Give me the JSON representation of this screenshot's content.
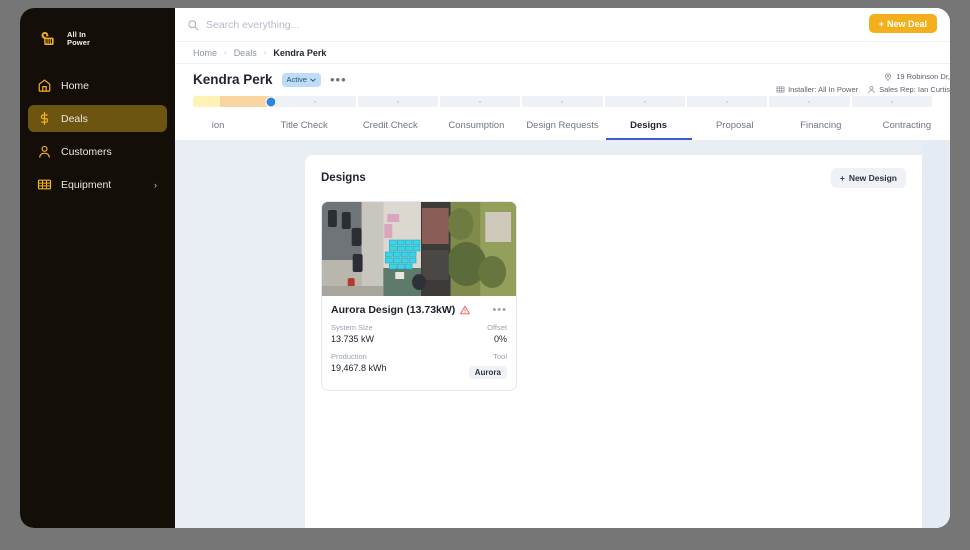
{
  "brand": {
    "name_line1": "All In",
    "name_line2": "Power",
    "accent": "#f3b01c"
  },
  "sidebar": {
    "items": [
      {
        "label": "Home",
        "icon": "home-icon",
        "active": false,
        "chevron": ""
      },
      {
        "label": "Deals",
        "icon": "dollar-icon",
        "active": true,
        "chevron": ""
      },
      {
        "label": "Customers",
        "icon": "person-icon",
        "active": false,
        "chevron": ""
      },
      {
        "label": "Equipment",
        "icon": "solar-panel-icon",
        "active": false,
        "chevron": "›"
      }
    ]
  },
  "topbar": {
    "search_placeholder": "Search everything...",
    "search_value": "",
    "new_deal_label": "New Deal",
    "new_deal_plus": "+"
  },
  "breadcrumb": {
    "items": [
      "Home",
      "Deals",
      "Kendra Perk"
    ],
    "separator": "›"
  },
  "deal": {
    "name": "Kendra Perk",
    "status": "Active",
    "status_chevron": "⌄",
    "more": "•••",
    "address": "19 Robinson Dr,",
    "installer": "Installer: All In Power",
    "sales_rep": "Sales Rep: Ian Curtis"
  },
  "stage_bar": {
    "segments": 9,
    "yellow_pct": 36,
    "orange_start_pct": 34,
    "marker_pct": 97
  },
  "tabs": [
    {
      "label": "ion",
      "active": false
    },
    {
      "label": "Title Check",
      "active": false
    },
    {
      "label": "Credit Check",
      "active": false
    },
    {
      "label": "Consumption",
      "active": false
    },
    {
      "label": "Design Requests",
      "active": false
    },
    {
      "label": "Designs",
      "active": true
    },
    {
      "label": "Proposal",
      "active": false
    },
    {
      "label": "Financing",
      "active": false
    },
    {
      "label": "Contracting",
      "active": false
    }
  ],
  "designs_panel": {
    "title": "Designs",
    "new_design_label": "New Design",
    "new_design_plus": "+",
    "cards": [
      {
        "title": "Aurora Design (13.73kW)",
        "warning_icon": "warning-triangle-icon",
        "more": "•••",
        "system_size_label": "System Size",
        "system_size_value": "13.735 kW",
        "offset_label": "Offset",
        "offset_value": "0%",
        "production_label": "Production",
        "production_value": "19,467.8 kWh",
        "tool_label": "Tool",
        "tool_value": "Aurora"
      }
    ]
  }
}
